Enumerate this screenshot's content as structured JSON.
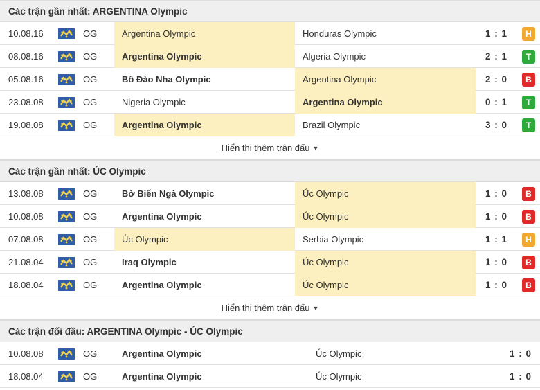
{
  "sections": [
    {
      "title": "Các trận gần nhất: ARGENTINA Olympic",
      "more_label": "Hiển thị thêm trận đấu",
      "matches": [
        {
          "date": "10.08.16",
          "comp": "OG",
          "home": "Argentina Olympic",
          "away": "Honduras Olympic",
          "score": "1 : 1",
          "result": "H",
          "home_bold": false,
          "away_bold": false,
          "hl": "home"
        },
        {
          "date": "08.08.16",
          "comp": "OG",
          "home": "Argentina Olympic",
          "away": "Algeria Olympic",
          "score": "2 : 1",
          "result": "T",
          "home_bold": true,
          "away_bold": false,
          "hl": "home"
        },
        {
          "date": "05.08.16",
          "comp": "OG",
          "home": "Bồ Đào Nha Olympic",
          "away": "Argentina Olympic",
          "score": "2 : 0",
          "result": "B",
          "home_bold": true,
          "away_bold": false,
          "hl": "away"
        },
        {
          "date": "23.08.08",
          "comp": "OG",
          "home": "Nigeria Olympic",
          "away": "Argentina Olympic",
          "score": "0 : 1",
          "result": "T",
          "home_bold": false,
          "away_bold": true,
          "hl": "away"
        },
        {
          "date": "19.08.08",
          "comp": "OG",
          "home": "Argentina Olympic",
          "away": "Brazil Olympic",
          "score": "3 : 0",
          "result": "T",
          "home_bold": true,
          "away_bold": false,
          "hl": "home"
        }
      ]
    },
    {
      "title": "Các trận gần nhất: ÚC Olympic",
      "more_label": "Hiển thị thêm trận đấu",
      "matches": [
        {
          "date": "13.08.08",
          "comp": "OG",
          "home": "Bờ Biển Ngà Olympic",
          "away": "Úc Olympic",
          "score": "1 : 0",
          "result": "B",
          "home_bold": true,
          "away_bold": false,
          "hl": "away"
        },
        {
          "date": "10.08.08",
          "comp": "OG",
          "home": "Argentina Olympic",
          "away": "Úc Olympic",
          "score": "1 : 0",
          "result": "B",
          "home_bold": true,
          "away_bold": false,
          "hl": "away"
        },
        {
          "date": "07.08.08",
          "comp": "OG",
          "home": "Úc Olympic",
          "away": "Serbia Olympic",
          "score": "1 : 1",
          "result": "H",
          "home_bold": false,
          "away_bold": false,
          "hl": "home"
        },
        {
          "date": "21.08.04",
          "comp": "OG",
          "home": "Iraq Olympic",
          "away": "Úc Olympic",
          "score": "1 : 0",
          "result": "B",
          "home_bold": true,
          "away_bold": false,
          "hl": "away"
        },
        {
          "date": "18.08.04",
          "comp": "OG",
          "home": "Argentina Olympic",
          "away": "Úc Olympic",
          "score": "1 : 0",
          "result": "B",
          "home_bold": true,
          "away_bold": false,
          "hl": "away"
        }
      ]
    }
  ],
  "h2h": {
    "title": "Các trận đối đầu: ARGENTINA Olympic - ÚC Olympic",
    "matches": [
      {
        "date": "10.08.08",
        "comp": "OG",
        "home": "Argentina Olympic",
        "away": "Úc Olympic",
        "score": "1 : 0",
        "home_bold": true
      },
      {
        "date": "18.08.04",
        "comp": "OG",
        "home": "Argentina Olympic",
        "away": "Úc Olympic",
        "score": "1 : 0",
        "home_bold": true
      }
    ]
  },
  "icons": {
    "competition_flag": "olympic-flag-icon",
    "more_caret": "caret-down-icon"
  },
  "colors": {
    "highlight": "#fdf0c0",
    "draw": "#f0a830",
    "win": "#2eaa3c",
    "loss": "#e02a2a",
    "header_bg": "#efefef"
  }
}
